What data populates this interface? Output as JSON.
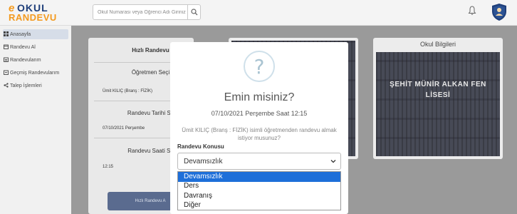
{
  "header": {
    "logo_e": "e",
    "logo_okul": "OKUL",
    "logo_randevu": "RANDEVU",
    "search_placeholder": "Okul Numarası veya Öğrenci Adı Giriniz",
    "icons": [
      "search-icon",
      "bell-icon",
      "shield-avatar-icon"
    ]
  },
  "sidebar": {
    "items": [
      {
        "label": "Anasayfa",
        "icon": "dashboard-icon",
        "active": true
      },
      {
        "label": "Randevu Al",
        "icon": "calendar-icon",
        "active": false
      },
      {
        "label": "Randevularım",
        "icon": "calendar-list-icon",
        "active": false
      },
      {
        "label": "Geçmiş Randevularım",
        "icon": "history-icon",
        "active": false
      },
      {
        "label": "Talep İşlemleri",
        "icon": "share-icon",
        "active": false
      }
    ]
  },
  "quick_form": {
    "title": "Hızlı Randevu",
    "teacher_label": "Öğretmen Seçi",
    "teacher_value": "Ümit KILIÇ (Branş : FİZİK)",
    "date_label": "Randevu Tarihi Se",
    "date_value": "07/10/2021 Perşembe",
    "time_label": "Randevu Saati Se",
    "time_value": "12:15",
    "button_label": "Hızlı Randevu A"
  },
  "cards": {
    "left_label": "",
    "right_label": "Okul Bilgileri",
    "school_name": "ŞEHİT MÜNİR ALKAN FEN LİSESİ"
  },
  "modal": {
    "icon": "question-icon",
    "icon_glyph": "?",
    "title": "Emin misiniz?",
    "subtitle": "07/10/2021 Perşembe Saat 12:15",
    "text": "Ümit KILIÇ (Branş : FİZİK) isimli öğretmenden randevu almak istiyor musunuz?",
    "select_label": "Randevu Konusu",
    "selected": "Devamsızlık",
    "options": [
      "Devamsızlık",
      "Ders",
      "Davranış",
      "Diğer"
    ],
    "highlighted_option": 0
  },
  "colors": {
    "accent_orange": "#f39a1f",
    "brand_navy": "#1f3f7a",
    "option_highlight": "#1e6fd9",
    "overlay": "#9a9a9a"
  }
}
